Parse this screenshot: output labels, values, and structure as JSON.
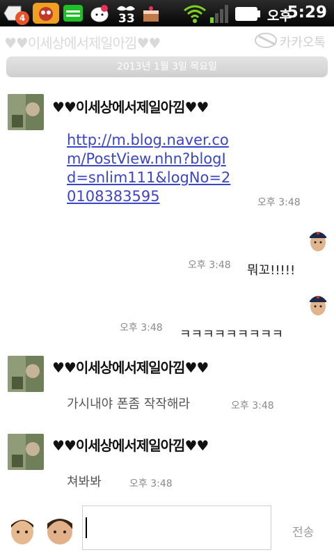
{
  "status": {
    "notification_count": "4",
    "counter": "33",
    "ampm": "오후",
    "time": "5:29"
  },
  "header": {
    "title": "♥♥이세상에서제일아낌♥♥",
    "brand": "카카오톡"
  },
  "date_separator": "2013년 1월 3일 목요일",
  "messages": [
    {
      "sender": "♥♥이세상에서제일아낌♥♥",
      "text": "http://m.blog.naver.com/PostView.nhn?blogId=snlim111&logNo=20108383595",
      "time": "오후 3:48"
    },
    {
      "sender": "me",
      "text": "뭐꼬!!!!!",
      "time": "오후 3:48"
    },
    {
      "sender": "me",
      "text": "ㅋㅋㅋㅋㅋㅋㅋㅋㅋ",
      "time": "오후 3:48"
    },
    {
      "sender": "♥♥이세상에서제일아낌♥♥",
      "text": "가시내야 폰좀 작작해라",
      "time": "오후 3:48"
    },
    {
      "sender": "♥♥이세상에서제일아낌♥♥",
      "text": "쳐봐봐",
      "time": "오후 3:48"
    }
  ],
  "composer": {
    "value": "",
    "send_label": "전송"
  },
  "colors": {
    "link": "#3b45c8",
    "status_bar": "#111111",
    "battery": "#ffffff",
    "wifi": "#7ed321"
  }
}
